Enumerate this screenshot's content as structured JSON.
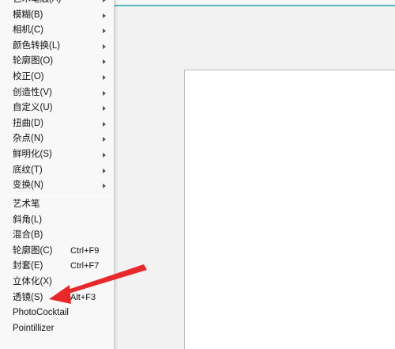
{
  "menu": {
    "submenu_items": [
      {
        "label": "艺术笔触(A)"
      },
      {
        "label": "模糊(B)"
      },
      {
        "label": "相机(C)"
      },
      {
        "label": "颜色转换(L)"
      },
      {
        "label": "轮廓图(O)"
      },
      {
        "label": "校正(O)"
      },
      {
        "label": "创造性(V)"
      },
      {
        "label": "自定义(U)"
      },
      {
        "label": "扭曲(D)"
      },
      {
        "label": "杂点(N)"
      },
      {
        "label": "鲜明化(S)"
      },
      {
        "label": "底纹(T)"
      },
      {
        "label": "变换(N)"
      }
    ],
    "plugin_items": [
      {
        "label": "艺术笔",
        "shortcut": ""
      },
      {
        "label": "斜角(L)",
        "shortcut": ""
      },
      {
        "label": "混合(B)",
        "shortcut": ""
      },
      {
        "label": "轮廓图(C)",
        "shortcut": "Ctrl+F9"
      },
      {
        "label": "封套(E)",
        "shortcut": "Ctrl+F7"
      },
      {
        "label": "立体化(X)",
        "shortcut": ""
      },
      {
        "label": "透镜(S)",
        "shortcut": "Alt+F3"
      },
      {
        "label": "PhotoCocktail",
        "shortcut": ""
      },
      {
        "label": "Pointillizer",
        "shortcut": ""
      }
    ]
  },
  "colors": {
    "accent_line": "#54b4b6",
    "arrow": "#e8292c"
  }
}
